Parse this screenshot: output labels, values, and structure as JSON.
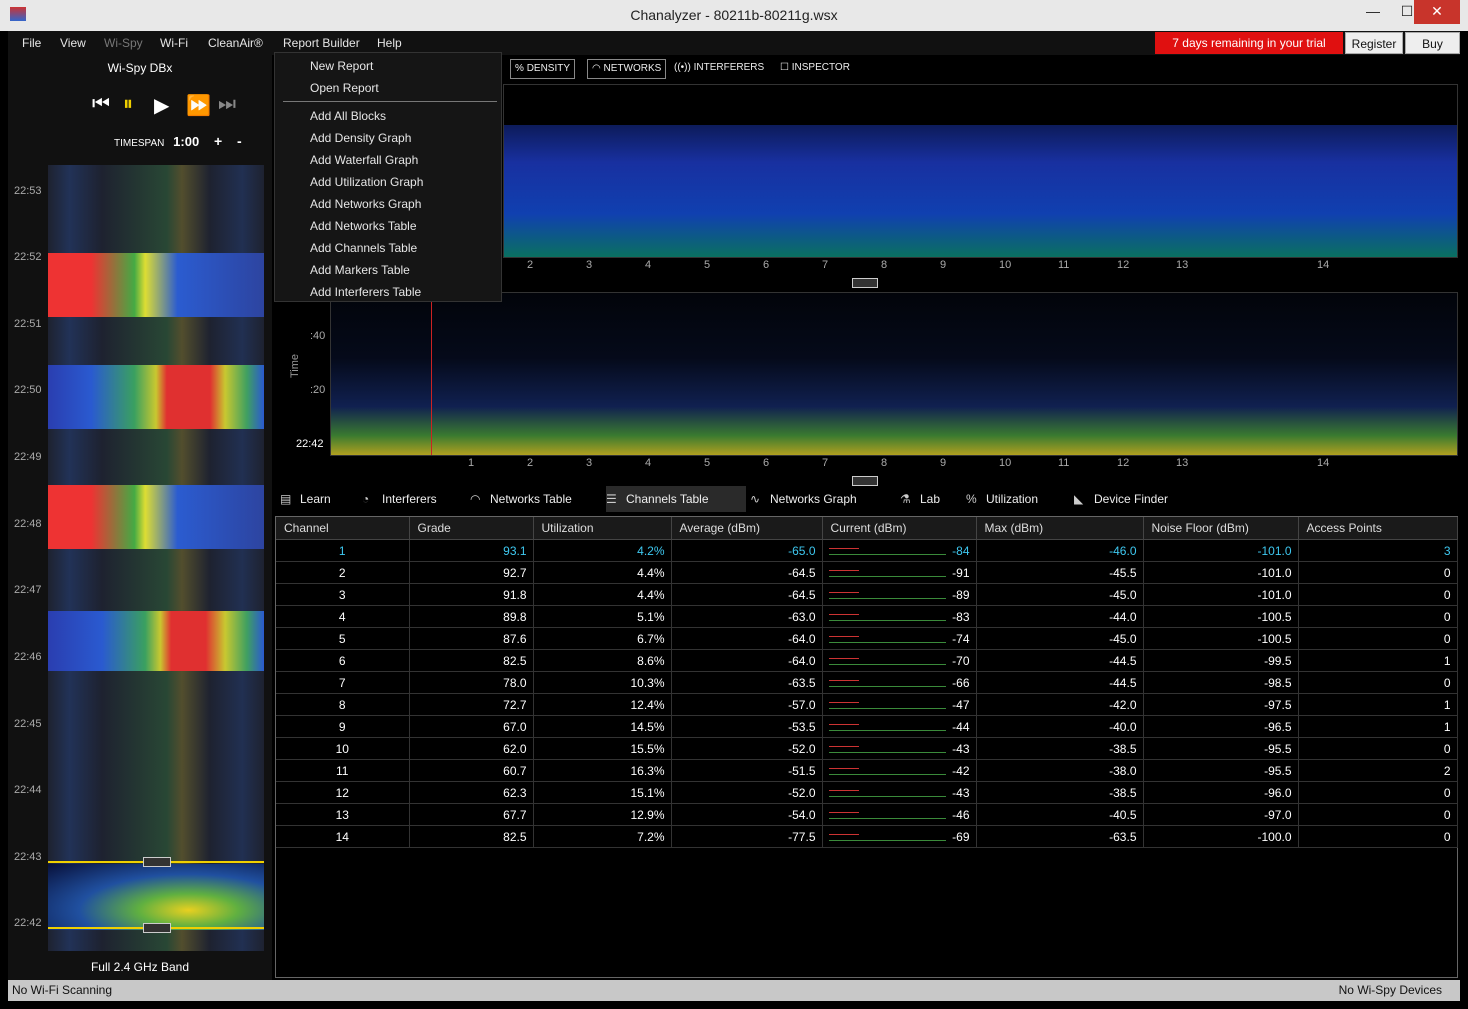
{
  "window": {
    "title": "Chanalyzer - 80211b-80211g.wsx",
    "min": "—",
    "max": "☐",
    "close": "✕"
  },
  "menubar": {
    "file": "File",
    "view": "View",
    "wispy": "Wi-Spy",
    "wifi": "Wi-Fi",
    "cleanair": "CleanAir®",
    "report_builder": "Report Builder",
    "help": "Help"
  },
  "trial": {
    "text": "7 days remaining in your trial",
    "register": "Register",
    "buy": "Buy"
  },
  "left": {
    "device": "Wi-Spy DBx",
    "timespan_label": "TIMESPAN",
    "timespan_value": "1:00",
    "plus": "+",
    "minus": "-",
    "times": [
      "22:53",
      "22:52",
      "22:51",
      "22:50",
      "22:49",
      "22:48",
      "22:47",
      "22:46",
      "22:45",
      "22:44",
      "22:43",
      "22:42"
    ],
    "band": "Full 2.4 GHz Band"
  },
  "dropdown": [
    "New Report",
    "Open Report",
    "Add All Blocks",
    "Add Density Graph",
    "Add Waterfall Graph",
    "Add Utilization Graph",
    "Add Networks Graph",
    "Add Networks Table",
    "Add Channels Table",
    "Add Markers Table",
    "Add Interferers Table"
  ],
  "toolbar": {
    "density": "DENSITY",
    "networks": "NETWORKS",
    "interferers": "INTERFERERS",
    "inspector": "INSPECTOR"
  },
  "axis": {
    "channels": [
      "2",
      "3",
      "4",
      "5",
      "6",
      "7",
      "8",
      "9",
      "10",
      "11",
      "12",
      "13",
      "14"
    ],
    "wf_channels": [
      "1",
      "2",
      "3",
      "4",
      "5",
      "6",
      "7",
      "8",
      "9",
      "10",
      "11",
      "12",
      "13",
      "14"
    ],
    "time_title": "Time",
    "t40": ":40",
    "t20": ":20",
    "t42": "22:42"
  },
  "tabs": [
    "Learn",
    "Interferers",
    "Networks Table",
    "Channels Table",
    "Networks Graph",
    "Lab",
    "Utilization",
    "Device Finder"
  ],
  "table": {
    "headers": [
      "Channel",
      "Grade",
      "Utilization",
      "Average (dBm)",
      "Current (dBm)",
      "Max (dBm)",
      "Noise Floor (dBm)",
      "Access Points"
    ],
    "rows": [
      [
        "1",
        "93.1",
        "4.2%",
        "-65.0",
        "-84",
        "-46.0",
        "-101.0",
        "3"
      ],
      [
        "2",
        "92.7",
        "4.4%",
        "-64.5",
        "-91",
        "-45.5",
        "-101.0",
        "0"
      ],
      [
        "3",
        "91.8",
        "4.4%",
        "-64.5",
        "-89",
        "-45.0",
        "-101.0",
        "0"
      ],
      [
        "4",
        "89.8",
        "5.1%",
        "-63.0",
        "-83",
        "-44.0",
        "-100.5",
        "0"
      ],
      [
        "5",
        "87.6",
        "6.7%",
        "-64.0",
        "-74",
        "-45.0",
        "-100.5",
        "0"
      ],
      [
        "6",
        "82.5",
        "8.6%",
        "-64.0",
        "-70",
        "-44.5",
        "-99.5",
        "1"
      ],
      [
        "7",
        "78.0",
        "10.3%",
        "-63.5",
        "-66",
        "-44.5",
        "-98.5",
        "0"
      ],
      [
        "8",
        "72.7",
        "12.4%",
        "-57.0",
        "-47",
        "-42.0",
        "-97.5",
        "1"
      ],
      [
        "9",
        "67.0",
        "14.5%",
        "-53.5",
        "-44",
        "-40.0",
        "-96.5",
        "1"
      ],
      [
        "10",
        "62.0",
        "15.5%",
        "-52.0",
        "-43",
        "-38.5",
        "-95.5",
        "0"
      ],
      [
        "11",
        "60.7",
        "16.3%",
        "-51.5",
        "-42",
        "-38.0",
        "-95.5",
        "2"
      ],
      [
        "12",
        "62.3",
        "15.1%",
        "-52.0",
        "-43",
        "-38.5",
        "-96.0",
        "0"
      ],
      [
        "13",
        "67.7",
        "12.9%",
        "-54.0",
        "-46",
        "-40.5",
        "-97.0",
        "0"
      ],
      [
        "14",
        "82.5",
        "7.2%",
        "-77.5",
        "-69",
        "-63.5",
        "-100.0",
        "0"
      ]
    ]
  },
  "status": {
    "left": "No Wi-Fi Scanning",
    "right": "No Wi-Spy Devices"
  },
  "colors": {
    "accent": "#3ec8f0",
    "trial": "#e01010",
    "marker": "#f0d000"
  }
}
